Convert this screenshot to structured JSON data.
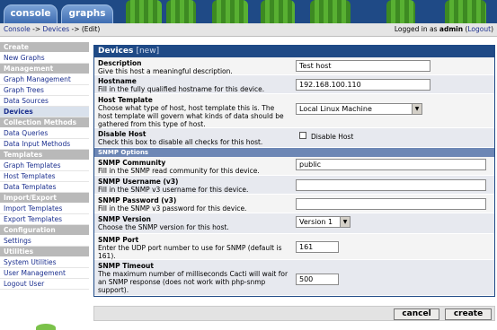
{
  "tabs": {
    "console": "console",
    "graphs": "graphs"
  },
  "breadcrumb": {
    "console": "Console",
    "sep1": " -> ",
    "devices": "Devices",
    "sep2": " -> ",
    "edit": "(Edit)"
  },
  "login": {
    "prefix": "Logged in as ",
    "user": "admin",
    "logout_open": "(",
    "logout": "Logout",
    "logout_close": ")"
  },
  "sidebar": [
    {
      "type": "head",
      "label": "Create"
    },
    {
      "type": "item",
      "label": "New Graphs"
    },
    {
      "type": "head",
      "label": "Management"
    },
    {
      "type": "item",
      "label": "Graph Management"
    },
    {
      "type": "item",
      "label": "Graph Trees"
    },
    {
      "type": "item",
      "label": "Data Sources"
    },
    {
      "type": "item",
      "label": "Devices",
      "selected": true
    },
    {
      "type": "head",
      "label": "Collection Methods"
    },
    {
      "type": "item",
      "label": "Data Queries"
    },
    {
      "type": "item",
      "label": "Data Input Methods"
    },
    {
      "type": "head",
      "label": "Templates"
    },
    {
      "type": "item",
      "label": "Graph Templates"
    },
    {
      "type": "item",
      "label": "Host Templates"
    },
    {
      "type": "item",
      "label": "Data Templates"
    },
    {
      "type": "head",
      "label": "Import/Export"
    },
    {
      "type": "item",
      "label": "Import Templates"
    },
    {
      "type": "item",
      "label": "Export Templates"
    },
    {
      "type": "head",
      "label": "Configuration"
    },
    {
      "type": "item",
      "label": "Settings"
    },
    {
      "type": "head",
      "label": "Utilities"
    },
    {
      "type": "item",
      "label": "System Utilities"
    },
    {
      "type": "item",
      "label": "User Management"
    },
    {
      "type": "item",
      "label": "Logout User"
    }
  ],
  "panel": {
    "title": "Devices",
    "title_new": "[new]"
  },
  "fields": {
    "description": {
      "label": "Description",
      "help": "Give this host a meaningful description.",
      "value": "Test host"
    },
    "hostname": {
      "label": "Hostname",
      "help": "Fill in the fully qualified hostname for this device.",
      "value": "192.168.100.110"
    },
    "host_template": {
      "label": "Host Template",
      "help": "Choose what type of host, host template this is. The host template will govern what kinds of data should be gathered from this type of host.",
      "value": "Local Linux Machine"
    },
    "disable_host": {
      "label": "Disable Host",
      "help": "Check this box to disable all checks for this host.",
      "checkbox_label": "Disable Host"
    },
    "snmp_header": "SNMP Options",
    "snmp_community": {
      "label": "SNMP Community",
      "help": "Fill in the SNMP read community for this device.",
      "value": "public"
    },
    "snmp_username": {
      "label": "SNMP Username (v3)",
      "help": "Fill in the SNMP v3 username for this device.",
      "value": ""
    },
    "snmp_password": {
      "label": "SNMP Password (v3)",
      "help": "Fill in the SNMP v3 password for this device.",
      "value": ""
    },
    "snmp_version": {
      "label": "SNMP Version",
      "help": "Choose the SNMP version for this host.",
      "value": "Version 1"
    },
    "snmp_port": {
      "label": "SNMP Port",
      "help": "Enter the UDP port number to use for SNMP (default is 161).",
      "value": "161"
    },
    "snmp_timeout": {
      "label": "SNMP Timeout",
      "help": "The maximum number of milliseconds Cacti will wait for an SNMP response (does not work with php-snmp support).",
      "value": "500"
    }
  },
  "buttons": {
    "cancel": "cancel",
    "create": "create"
  },
  "icons": {
    "dropdown": "chevron-down-icon"
  },
  "colors": {
    "header_blue": "#1f4a86",
    "sidebar_head": "#b9b9b9",
    "link": "#1b2f8f"
  }
}
